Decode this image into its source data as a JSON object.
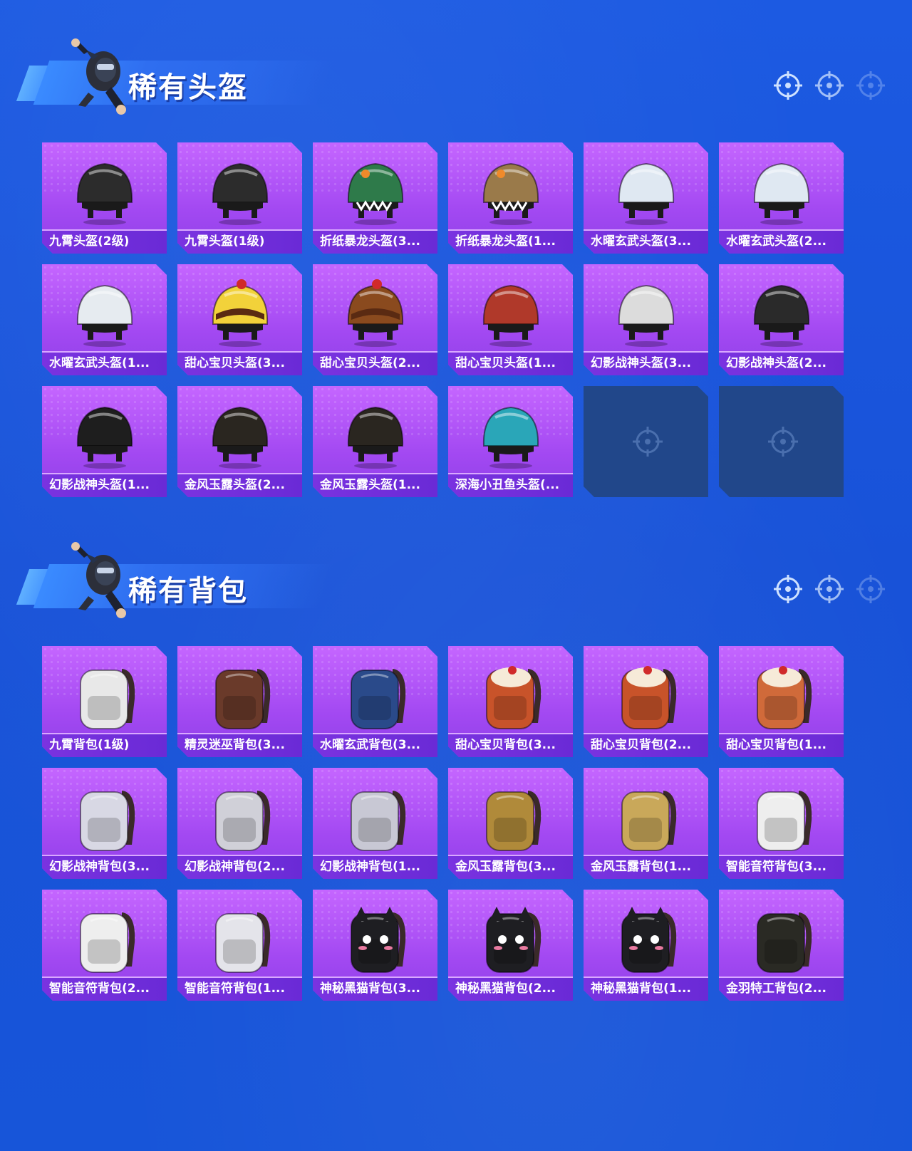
{
  "sections": [
    {
      "title": "稀有头盔",
      "items": [
        {
          "label": "九霄头盔(2级)",
          "icon": "helmet-icon",
          "color": "#2c2c2c"
        },
        {
          "label": "九霄头盔(1级)",
          "icon": "helmet-icon",
          "color": "#2c2c2c"
        },
        {
          "label": "折纸暴龙头盔(3...",
          "icon": "dino-helmet-icon",
          "color": "#2e7a4a"
        },
        {
          "label": "折纸暴龙头盔(1...",
          "icon": "dino-helmet-icon",
          "color": "#9a7a4a"
        },
        {
          "label": "水曜玄武头盔(3...",
          "icon": "helmet-icon",
          "color": "#dfe8f2"
        },
        {
          "label": "水曜玄武头盔(2...",
          "icon": "helmet-icon",
          "color": "#dfe8f2"
        },
        {
          "label": "水曜玄武头盔(1...",
          "icon": "helmet-icon",
          "color": "#e6ebf0"
        },
        {
          "label": "甜心宝贝头盔(3...",
          "icon": "cake-helmet-icon",
          "color": "#f2d23a"
        },
        {
          "label": "甜心宝贝头盔(2...",
          "icon": "cake-helmet-icon",
          "color": "#8a4a1e"
        },
        {
          "label": "甜心宝贝头盔(1...",
          "icon": "helmet-icon",
          "color": "#b0392a"
        },
        {
          "label": "幻影战神头盔(3...",
          "icon": "helmet-icon",
          "color": "#dcdcdc"
        },
        {
          "label": "幻影战神头盔(2...",
          "icon": "helmet-icon",
          "color": "#2a2a2a"
        },
        {
          "label": "幻影战神头盔(1...",
          "icon": "helmet-icon",
          "color": "#1e1e1e"
        },
        {
          "label": "金风玉露头盔(2...",
          "icon": "helmet-icon",
          "color": "#2a2620"
        },
        {
          "label": "金风玉露头盔(1...",
          "icon": "helmet-icon",
          "color": "#2a2620"
        },
        {
          "label": "深海小丑鱼头盔(...",
          "icon": "helmet-icon",
          "color": "#2aa6b8"
        },
        {
          "label": "",
          "icon": "empty-slot-icon",
          "color": ""
        },
        {
          "label": "",
          "icon": "empty-slot-icon",
          "color": ""
        }
      ]
    },
    {
      "title": "稀有背包",
      "items": [
        {
          "label": "九霄背包(1级)",
          "icon": "backpack-icon",
          "color": "#e8e8e8"
        },
        {
          "label": "精灵迷巫背包(3...",
          "icon": "backpack-icon",
          "color": "#6a3a2a"
        },
        {
          "label": "水曜玄武背包(3...",
          "icon": "backpack-icon",
          "color": "#2a4a8a"
        },
        {
          "label": "甜心宝贝背包(3...",
          "icon": "cake-backpack-icon",
          "color": "#c8532a"
        },
        {
          "label": "甜心宝贝背包(2...",
          "icon": "cake-backpack-icon",
          "color": "#c8532a"
        },
        {
          "label": "甜心宝贝背包(1...",
          "icon": "cake-backpack-icon",
          "color": "#d06a3a"
        },
        {
          "label": "幻影战神背包(3...",
          "icon": "backpack-icon",
          "color": "#d8d8e4"
        },
        {
          "label": "幻影战神背包(2...",
          "icon": "backpack-icon",
          "color": "#d0d0d8"
        },
        {
          "label": "幻影战神背包(1...",
          "icon": "backpack-icon",
          "color": "#c8c8d4"
        },
        {
          "label": "金风玉露背包(3...",
          "icon": "backpack-icon",
          "color": "#b08a3a"
        },
        {
          "label": "金风玉露背包(1...",
          "icon": "backpack-icon",
          "color": "#c9a85a"
        },
        {
          "label": "智能音符背包(3...",
          "icon": "backpack-icon",
          "color": "#eeeeee"
        },
        {
          "label": "智能音符背包(2...",
          "icon": "backpack-icon",
          "color": "#eeeeee"
        },
        {
          "label": "智能音符背包(1...",
          "icon": "backpack-icon",
          "color": "#e4e4ea"
        },
        {
          "label": "神秘黑猫背包(3...",
          "icon": "cat-backpack-icon",
          "color": "#1e1e22"
        },
        {
          "label": "神秘黑猫背包(2...",
          "icon": "cat-backpack-icon",
          "color": "#1e1e22"
        },
        {
          "label": "神秘黑猫背包(1...",
          "icon": "cat-backpack-icon",
          "color": "#1e1e22"
        },
        {
          "label": "金羽特工背包(2...",
          "icon": "backpack-icon",
          "color": "#2a2a24"
        }
      ]
    }
  ]
}
